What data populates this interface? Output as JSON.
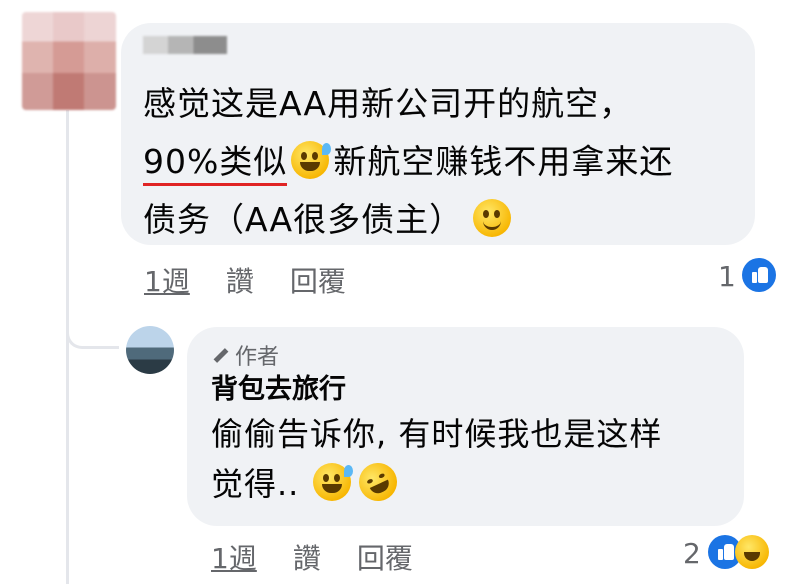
{
  "comment": {
    "line1": "感觉这是AA用新公司开的航空，",
    "line2_underlined": "90%类似",
    "line2_rest": "新航空赚钱不用拿来还",
    "line3": "债务（AA很多债主）",
    "actions": {
      "time": "1週",
      "like": "讚",
      "reply": "回覆"
    },
    "reaction_count": "1"
  },
  "reply": {
    "badge": "作者",
    "author": "背包去旅行",
    "line1": "偷偷告诉你, 有时候我也是这样",
    "line2": "觉得..",
    "actions": {
      "time": "1週",
      "like": "讚",
      "reply": "回覆"
    },
    "reaction_count": "2"
  },
  "icons": {
    "like_color": "#1b74e4",
    "emojis": [
      "grinning-sweat-emoji",
      "slightly-smiling-emoji",
      "rofl-emoji",
      "haha-reaction"
    ]
  }
}
